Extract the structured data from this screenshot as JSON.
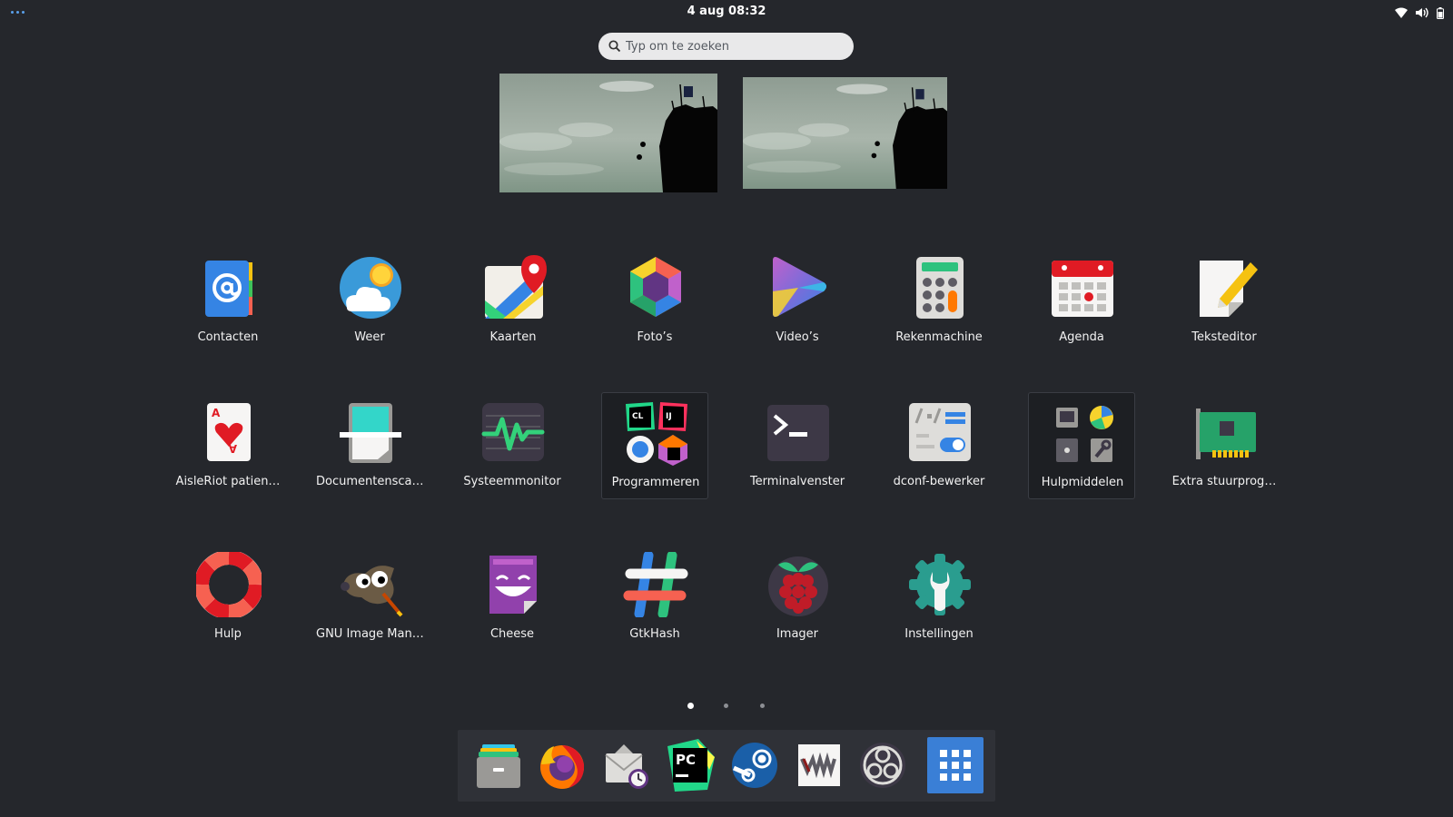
{
  "topbar": {
    "clock": "4 aug  08:32",
    "tray_icons": [
      "wifi-icon",
      "volume-icon",
      "battery-icon"
    ]
  },
  "search": {
    "placeholder": "Typ om te zoeken"
  },
  "apps": [
    {
      "label": "Contacten",
      "icon": "contacts-icon"
    },
    {
      "label": "Weer",
      "icon": "weather-icon"
    },
    {
      "label": "Kaarten",
      "icon": "maps-icon"
    },
    {
      "label": "Foto’s",
      "icon": "photos-icon"
    },
    {
      "label": "Video’s",
      "icon": "videos-icon"
    },
    {
      "label": "Rekenmachine",
      "icon": "calculator-icon"
    },
    {
      "label": "Agenda",
      "icon": "calendar-icon"
    },
    {
      "label": "Teksteditor",
      "icon": "text-editor-icon"
    },
    {
      "label": "AisleRiot patien…",
      "icon": "aisleriot-icon"
    },
    {
      "label": "Documentensca…",
      "icon": "document-scanner-icon"
    },
    {
      "label": "Systeemmonitor",
      "icon": "system-monitor-icon"
    },
    {
      "label": "Programmeren",
      "icon": "programming-folder-icon",
      "folder": true
    },
    {
      "label": "Terminalvenster",
      "icon": "terminal-icon"
    },
    {
      "label": "dconf-bewerker",
      "icon": "dconf-editor-icon"
    },
    {
      "label": "Hulpmiddelen",
      "icon": "utilities-folder-icon",
      "folder": true
    },
    {
      "label": "Extra stuurprog…",
      "icon": "additional-drivers-icon"
    },
    {
      "label": "Hulp",
      "icon": "help-icon"
    },
    {
      "label": "GNU Image Man…",
      "icon": "gimp-icon"
    },
    {
      "label": "Cheese",
      "icon": "cheese-icon"
    },
    {
      "label": "GtkHash",
      "icon": "gtkhash-icon"
    },
    {
      "label": "Imager",
      "icon": "raspberry-pi-imager-icon"
    },
    {
      "label": "Instellingen",
      "icon": "settings-icon"
    }
  ],
  "folder_programmeren": {
    "mini_labels": [
      "CL",
      "IJ"
    ]
  },
  "pages": {
    "count": 3,
    "current": 1
  },
  "dash": [
    "files-icon",
    "firefox-icon",
    "mail-client-icon",
    "pycharm-icon",
    "steam-icon",
    "vmware-icon",
    "obs-studio-icon",
    "show-applications-icon"
  ],
  "colors": {
    "background": "#25272c",
    "accent": "#3a7fd6",
    "search_bg": "#e9e9ea"
  }
}
